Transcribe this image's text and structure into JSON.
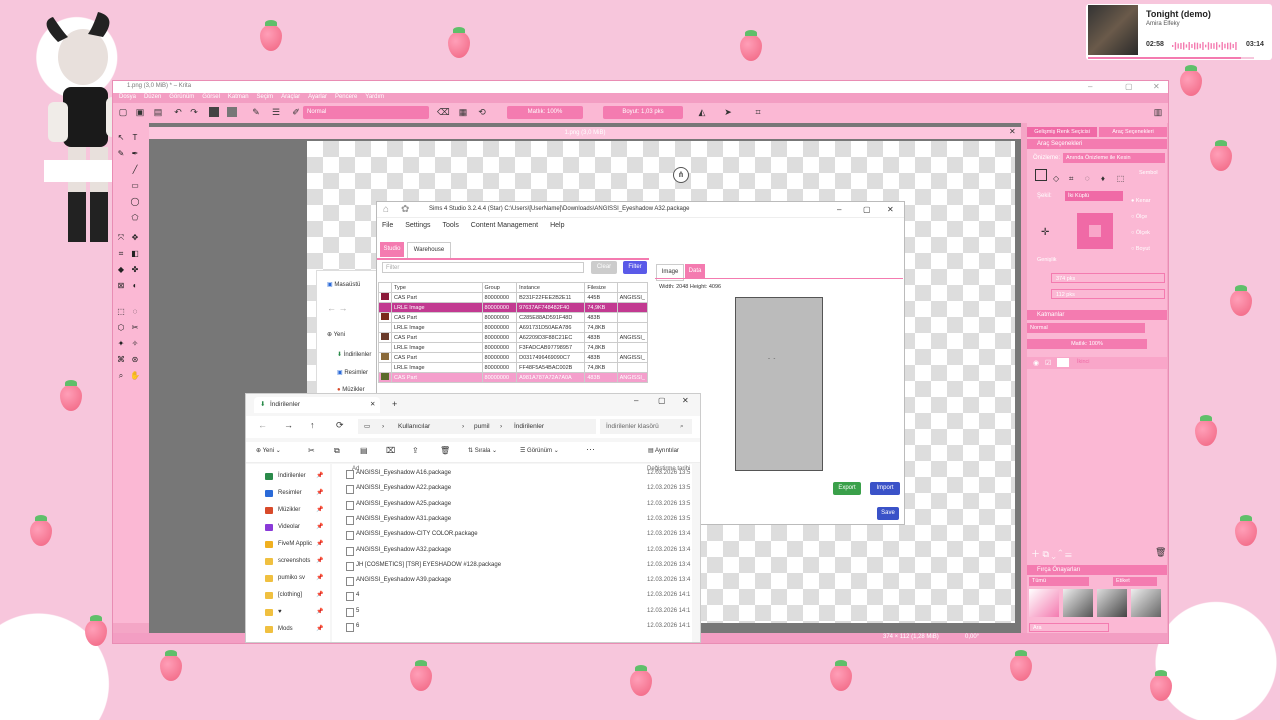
{
  "music": {
    "title": "Tonight (demo)",
    "artist": "Amira Elfeky",
    "elapsed": "02:58",
    "total": "03:14",
    "progress": 0.92
  },
  "krita": {
    "window_title": "1.png (3,0 MiB) * – Krita",
    "menu": [
      "Dosya",
      "Düzen",
      "Görünüm",
      "Görsel",
      "Katman",
      "Seçim",
      "Araçlar",
      "Ayarlar",
      "Pencere",
      "Yardım"
    ],
    "blend_mode": "Normal",
    "opacity": "Matlık: 100%",
    "size": "Boyut: 1,03 pks",
    "doc_tab": "1.png (3,0 MiB)",
    "right_tabs": [
      "Gelişmiş Renk Seçicisi",
      "Araç Seçenekleri"
    ],
    "tool_options_header": "Araç Seçenekleri",
    "onizleme_label": "Önizleme:",
    "onizleme_value": "Anında Önizleme ile Kesin",
    "sekil_label": "Şekil:",
    "sekil_value": "İki Küplü",
    "option_labels": [
      "Kenar",
      "Ölçe",
      "Ölçek",
      "Boyut"
    ],
    "genislik_label": "Genişlik",
    "w_value": "374 pks",
    "h_value": "112 pks",
    "layers_header": "Katmanlar",
    "layer_blend": "Normal",
    "layer_opacity": "Matlık: 100%",
    "layer_name": "İkinci",
    "presets_header": "Fırça Önayarları",
    "presets_filter": "Tümü",
    "presets_tag": "Etiket",
    "presets_search": "Ara",
    "status_size": "374 × 112 (1,28 MiB)",
    "status_angle": "0,00°",
    "side_label": "Sembol"
  },
  "sims4": {
    "title": "Sims 4 Studio 3.2.4.4 (Star)  C:\\Users\\[UserName]\\Downloads\\ANGISSI_Eyeshadow A32.package",
    "menu": [
      "File",
      "Settings",
      "Tools",
      "Content Management",
      "Help"
    ],
    "tab_studio": "Studio",
    "tab_warehouse": "Warehouse",
    "filter_placeholder": "Filter",
    "clear": "Clear",
    "filter": "Filter",
    "columns": [
      "Type",
      "Group",
      "Instance",
      "Filesize"
    ],
    "rows": [
      {
        "swatch": "#8b1a3a",
        "type": "CAS Part",
        "group": "80000000",
        "instance": "B231F22FEE2B2E11",
        "size": "445B",
        "extra": "ANGISSI_",
        "sel": ""
      },
      {
        "swatch": "",
        "type": "LRLE Image",
        "group": "80000000",
        "instance": "97637AF748482F40",
        "size": "74,9KB",
        "extra": "",
        "sel": "sel"
      },
      {
        "swatch": "#7a2a1a",
        "type": "CAS Part",
        "group": "80000000",
        "instance": "C285E88AD591F48D",
        "size": "483B",
        "extra": "",
        "sel": ""
      },
      {
        "swatch": "",
        "type": "LRLE Image",
        "group": "80000000",
        "instance": "A691731D50AEA786",
        "size": "74,8KB",
        "extra": "",
        "sel": ""
      },
      {
        "swatch": "#6a3a2a",
        "type": "CAS Part",
        "group": "80000000",
        "instance": "A62209D3F88C21EC",
        "size": "483B",
        "extra": "ANGISSI_",
        "sel": ""
      },
      {
        "swatch": "",
        "type": "LRLE Image",
        "group": "80000000",
        "instance": "F3FADCAB97798957",
        "size": "74,8KB",
        "extra": "",
        "sel": ""
      },
      {
        "swatch": "#8a6a3a",
        "type": "CAS Part",
        "group": "80000000",
        "instance": "D0317496469090C7",
        "size": "483B",
        "extra": "ANGISSI_",
        "sel": ""
      },
      {
        "swatch": "",
        "type": "LRLE Image",
        "group": "80000000",
        "instance": "FF48F5A54BAC002B",
        "size": "74,8KB",
        "extra": "",
        "sel": ""
      },
      {
        "swatch": "#5a6a2a",
        "type": "CAS Part",
        "group": "80000000",
        "instance": "A981A787A72A7A0A",
        "size": "483B",
        "extra": "ANGISSI_",
        "sel": "sel2"
      }
    ],
    "tab_image": "Image",
    "tab_data": "Data",
    "dims": "Width: 2048 Height: 4096",
    "export": "Export",
    "import": "Import",
    "save": "Save"
  },
  "explorer_back": {
    "items": [
      "Masaüstü",
      "Yeni",
      "İndirilenler",
      "Resimler",
      "Müzikler"
    ]
  },
  "explorer": {
    "tab": "İndirilenler",
    "breadcrumb": [
      "Kullanıcılar",
      "pumil",
      "İndirilenler"
    ],
    "search_placeholder": "İndirilenler klasörü",
    "new": "Yeni",
    "sort": "Sırala",
    "view": "Görünüm",
    "details": "Ayrıntılar",
    "col_name": "Ad",
    "col_date": "Değiştirme tarihi",
    "sidebar": [
      {
        "label": "İndirilenler",
        "color": "#2a8a4a"
      },
      {
        "label": "Resimler",
        "color": "#2a6ad8"
      },
      {
        "label": "Müzikler",
        "color": "#d84a2a"
      },
      {
        "label": "Videolar",
        "color": "#8a3ad8"
      },
      {
        "label": "FiveM Applic",
        "color": "#f0b020"
      },
      {
        "label": "screenshots",
        "color": "#f0c040"
      },
      {
        "label": "pumiko sv",
        "color": "#f0c040"
      },
      {
        "label": "[clothing]",
        "color": "#f0c040"
      },
      {
        "label": "♥",
        "color": "#f0c040"
      },
      {
        "label": "Mods",
        "color": "#f0c040"
      }
    ],
    "files": [
      {
        "name": "ANGISSI_Eyeshadow A16.package",
        "date": "12.03.2026 13:5"
      },
      {
        "name": "ANGISSI_Eyeshadow A22.package",
        "date": "12.03.2026 13:5"
      },
      {
        "name": "ANGISSI_Eyeshadow A25.package",
        "date": "12.03.2026 13:5"
      },
      {
        "name": "ANGISSI_Eyeshadow A31.package",
        "date": "12.03.2026 13:5"
      },
      {
        "name": "ANGISSI_Eyeshadow-CITY COLOR.package",
        "date": "12.03.2026 13:4"
      },
      {
        "name": "ANGISSI_Eyeshadow A32.package",
        "date": "12.03.2026 13:4"
      },
      {
        "name": "JH [COSMETICS] [TSR] EYESHADOW #128.package",
        "date": "12.03.2026 13:4"
      },
      {
        "name": "ANGISSI_Eyeshadow A39.package",
        "date": "12.03.2026 13:4"
      },
      {
        "name": "4",
        "date": "12.03.2026 14:1"
      },
      {
        "name": "5",
        "date": "12.03.2026 14:1"
      },
      {
        "name": "6",
        "date": "12.03.2026 14:1"
      }
    ]
  }
}
